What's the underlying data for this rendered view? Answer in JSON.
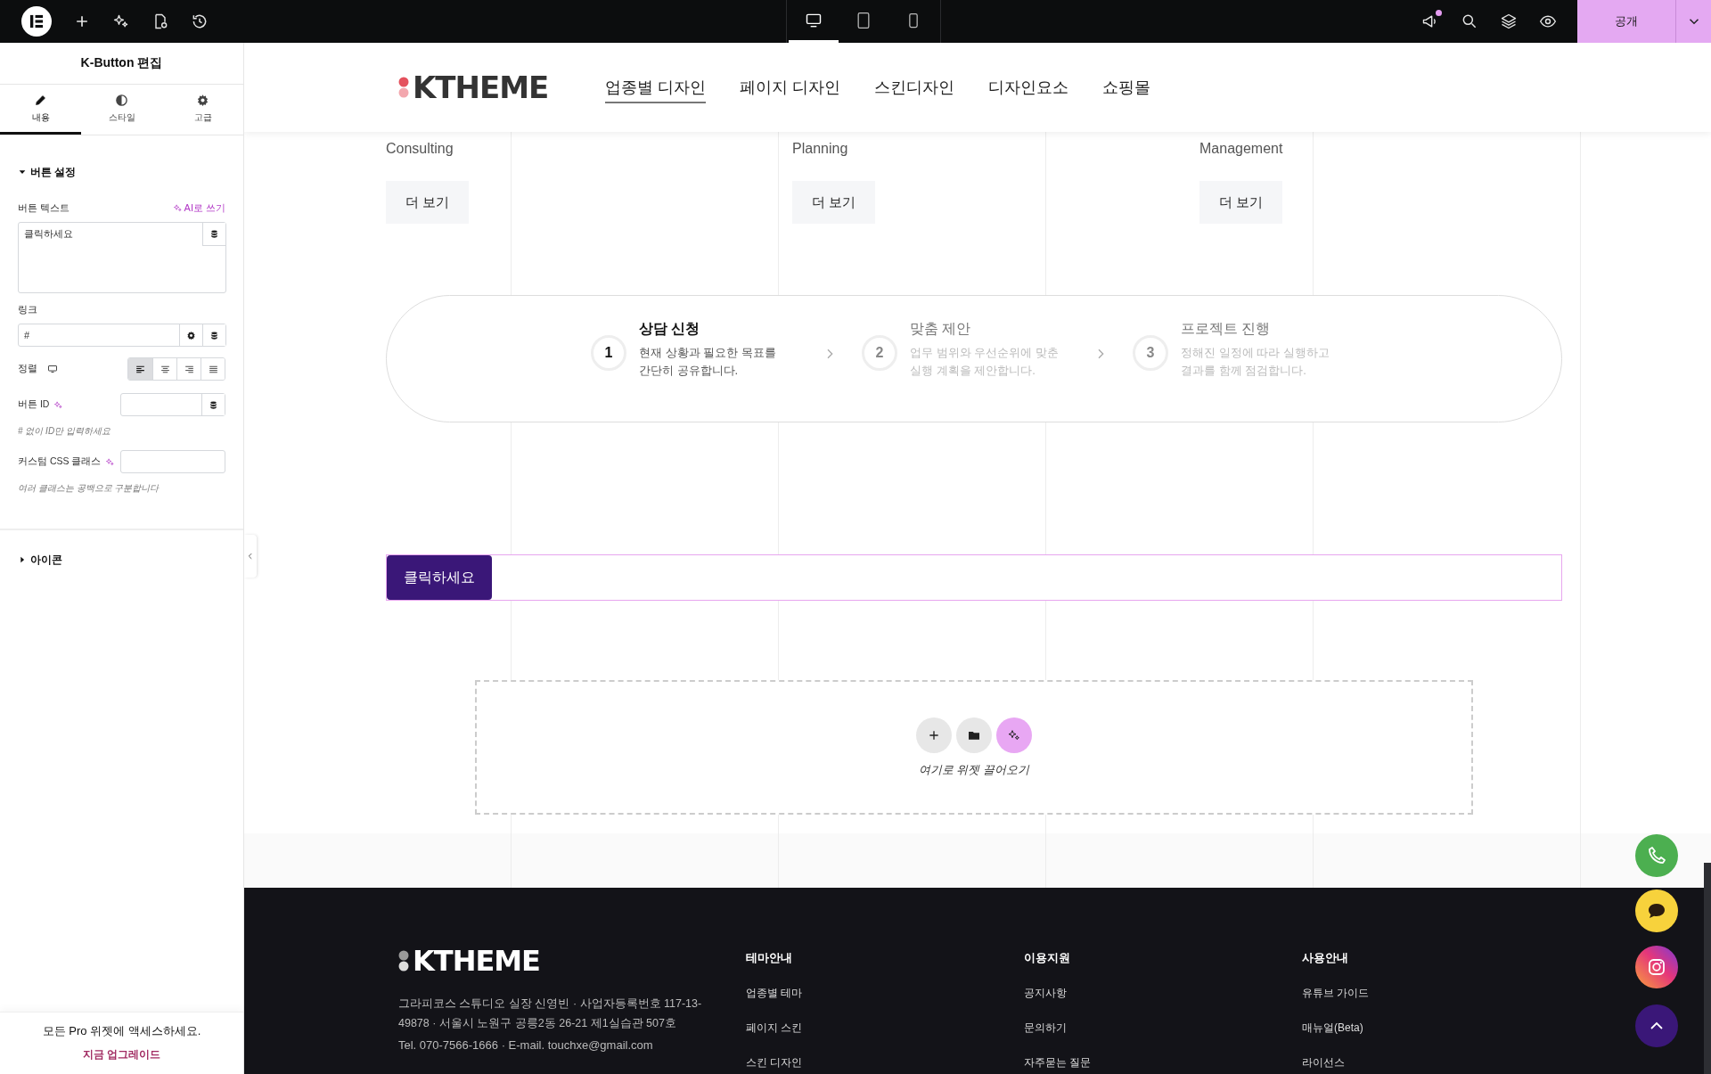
{
  "top_bar": {
    "tools": [
      {
        "kind": "logo"
      },
      {
        "kind": "add"
      },
      {
        "kind": "ai"
      },
      {
        "kind": "page-settings"
      },
      {
        "kind": "history"
      }
    ],
    "devices": [
      {
        "kind": "desktop",
        "selected": true
      },
      {
        "kind": "tablet",
        "selected": false
      },
      {
        "kind": "mobile",
        "selected": false
      }
    ],
    "actions": [
      {
        "kind": "announcements",
        "notification": true
      },
      {
        "kind": "search",
        "notification": false
      },
      {
        "kind": "layers",
        "notification": false
      },
      {
        "kind": "preview",
        "notification": false
      }
    ],
    "publish_button": "공개"
  },
  "panel": {
    "title": "K-Button 편집",
    "tabs": [
      {
        "label": "내용",
        "kind": "content",
        "selected": true
      },
      {
        "label": "스타일",
        "kind": "style",
        "selected": false
      },
      {
        "label": "고급",
        "kind": "advanced",
        "selected": false
      }
    ],
    "sections": [
      {
        "title": "버튼 설정",
        "expanded": true,
        "fields": [
          {
            "kind": "textarea",
            "label": "버튼 텍스트",
            "ai_label": "AI로 쓰기",
            "value": "클릭하세요"
          },
          {
            "kind": "url",
            "label": "링크",
            "value": "#"
          },
          {
            "kind": "align",
            "label": "정렬",
            "options": [
              {
                "kind": "left",
                "selected": true
              },
              {
                "kind": "center",
                "selected": false
              },
              {
                "kind": "right",
                "selected": false
              },
              {
                "kind": "justify",
                "selected": false
              }
            ]
          },
          {
            "kind": "text",
            "label": "버튼 ID",
            "ai": true,
            "dynamic": true,
            "description": "# 없이 ID만 입력하세요"
          },
          {
            "kind": "text",
            "label": "커스텀 CSS 클래스",
            "ai": true,
            "dynamic": false,
            "description": "여러 클래스는 공백으로 구분합니다"
          }
        ]
      },
      {
        "title": "아이콘",
        "expanded": false
      }
    ],
    "promo": {
      "text": "모든 Pro 위젯에 액세스하세요.",
      "link": "지금 업그레이드"
    }
  },
  "canvas": {
    "nav": {
      "logo": "KTHEME",
      "items": [
        {
          "label": "업종별 디자인",
          "selected": true
        },
        {
          "label": "페이지 디자인",
          "selected": false
        },
        {
          "label": "스킨디자인",
          "selected": false
        },
        {
          "label": "디자인요소",
          "selected": false
        },
        {
          "label": "쇼핑몰",
          "selected": false
        }
      ]
    },
    "cards": [
      {
        "title": "Consulting",
        "button": "더 보기"
      },
      {
        "title": "Planning",
        "button": "더 보기"
      },
      {
        "title": "Management",
        "button": "더 보기"
      }
    ],
    "steps": [
      {
        "number": "1",
        "title": "상담 신청",
        "text": "현재 상황과 필요한 목표를 간단히 공유합니다.",
        "active": true
      },
      {
        "number": "2",
        "title": "맞춤 제안",
        "text": "업무 범위와 우선순위에 맞춘 실행 계획을 제안합니다.",
        "active": false
      },
      {
        "number": "3",
        "title": "프로젝트 진행",
        "text": "정해진 일정에 따라 실행하고 결과를 함께 점검합니다.",
        "active": false
      }
    ],
    "button": "클릭하세요",
    "drop_zone": {
      "tools": [
        {
          "kind": "add"
        },
        {
          "kind": "template"
        },
        {
          "kind": "ai"
        }
      ],
      "hint": "여기로 위젯 끌어오기"
    },
    "footer": {
      "logo": "KTHEME",
      "address": "그라피코스 스튜디오 실장 신영빈 · 사업자등록번호 117-13-49878 · 서울시 노원구 공릉2동 26-21 제1실습관 507호",
      "contact": "Tel. 070-7566-1666 · E-mail. touchxe@gmail.com",
      "columns": [
        {
          "title": "테마안내",
          "links": [
            "업종별 테마",
            "페이지 스킨",
            "스킨 디자인"
          ]
        },
        {
          "title": "이용지원",
          "links": [
            "공지사항",
            "문의하기",
            "자주묻는 질문"
          ]
        },
        {
          "title": "사용안내",
          "links": [
            "유튜브 가이드",
            "매뉴얼(Beta)",
            "라이선스"
          ]
        }
      ]
    },
    "floating_buttons": [
      {
        "kind": "phone"
      },
      {
        "kind": "chat"
      },
      {
        "kind": "instagram"
      },
      {
        "kind": "top"
      }
    ]
  }
}
